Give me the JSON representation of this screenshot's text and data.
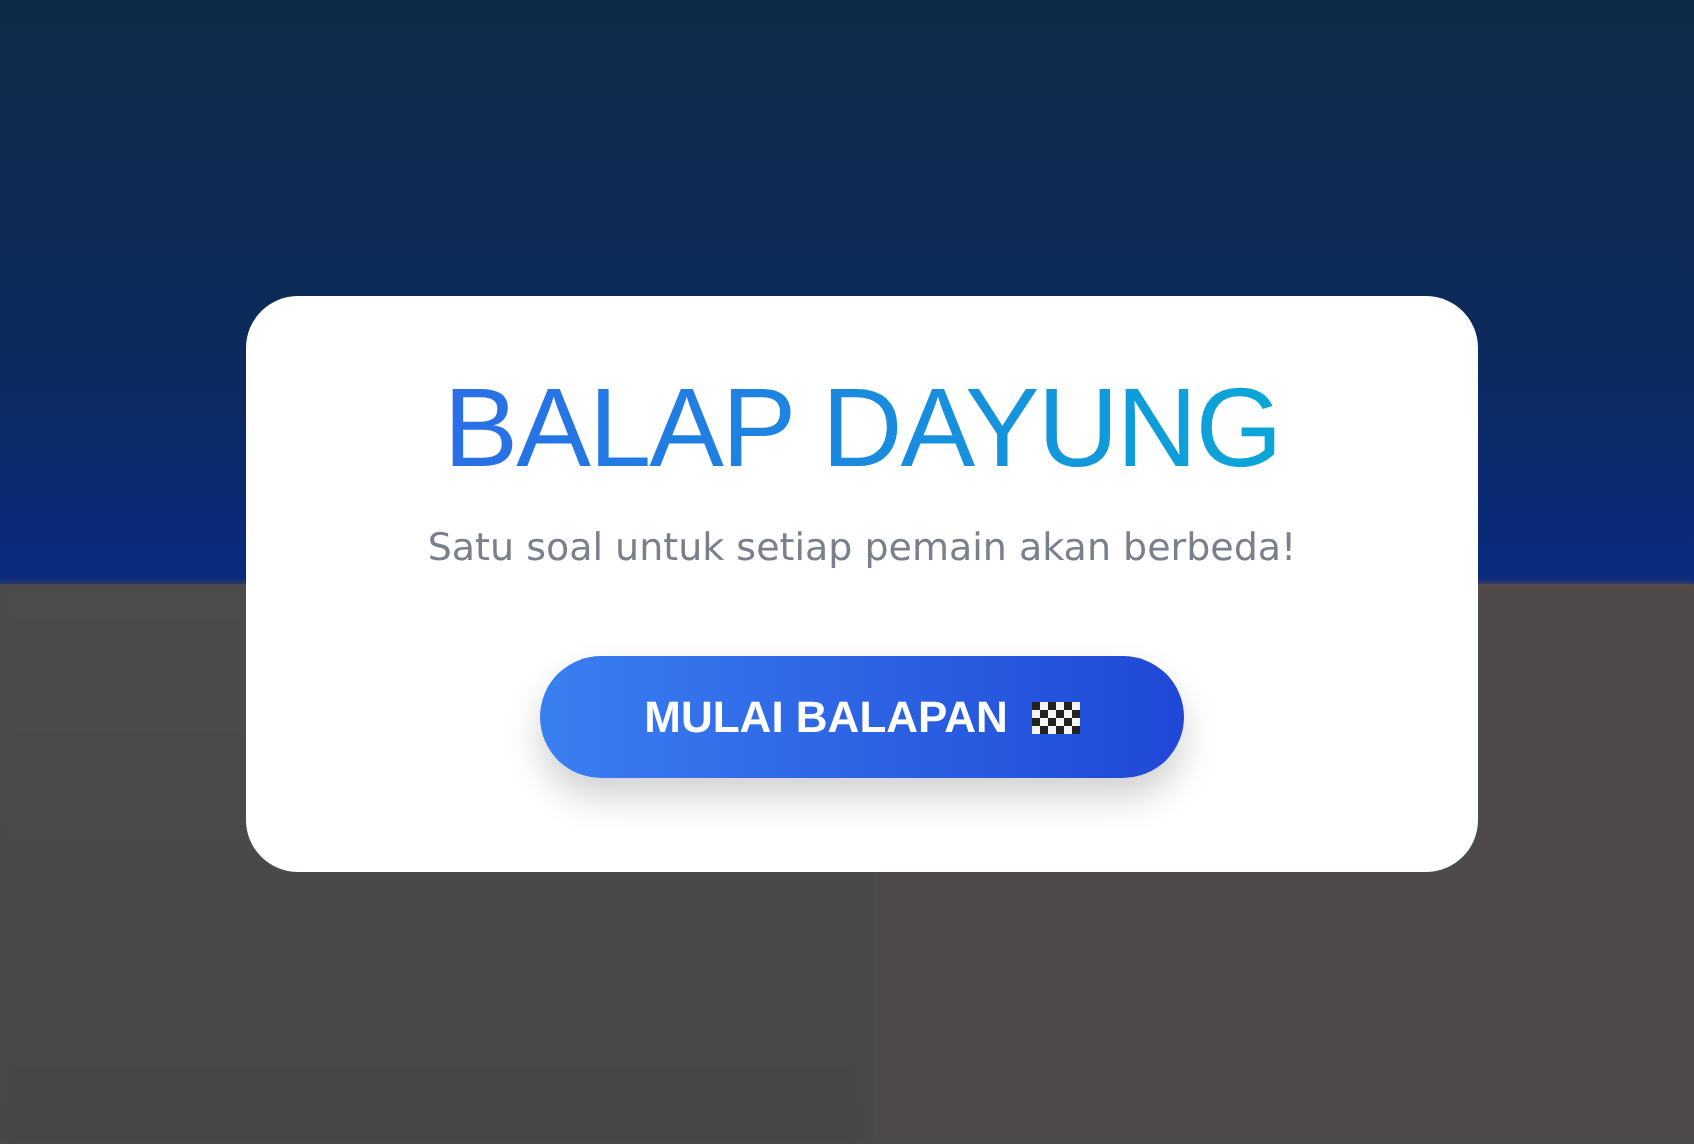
{
  "dialog": {
    "title": "BALAP DAYUNG",
    "subtitle": "Satu soal untuk setiap pemain akan berbeda!",
    "start_button": {
      "label": "MULAI BALAPAN"
    }
  }
}
